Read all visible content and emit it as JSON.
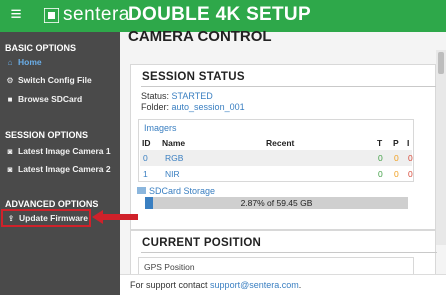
{
  "header": {
    "menu_icon": "≡",
    "logo_text": "sentera",
    "title": "DOUBLE 4K SETUP",
    "brand_color": "#2ea84a"
  },
  "sidebar": {
    "sections": [
      {
        "title": "BASIC OPTIONS"
      },
      {
        "title": "SESSION OPTIONS"
      },
      {
        "title": "ADVANCED OPTIONS"
      }
    ],
    "items": [
      {
        "label": "Home",
        "icon": "home-icon",
        "active": true
      },
      {
        "label": "Switch Config File",
        "icon": "gears-icon"
      },
      {
        "label": "Browse SDCard",
        "icon": "folder-icon"
      },
      {
        "label": "Latest Image Camera 1",
        "icon": "camera-icon"
      },
      {
        "label": "Latest Image Camera 2",
        "icon": "camera-icon"
      },
      {
        "label": "Update Firmware",
        "icon": "upload-icon",
        "highlighted": true
      }
    ]
  },
  "main": {
    "title": "CAMERA CONTROL",
    "session_status": {
      "title": "SESSION STATUS",
      "status_label": "Status:",
      "status_value": "STARTED",
      "folder_label": "Folder:",
      "folder_value": "auto_session_001"
    },
    "imagers": {
      "label": "Imagers",
      "columns": [
        "ID",
        "Name",
        "Recent",
        "T",
        "P",
        "I"
      ],
      "rows": [
        {
          "id": "0",
          "name": "RGB",
          "recent": "",
          "t": "0",
          "p": "0",
          "i": "0"
        },
        {
          "id": "1",
          "name": "NIR",
          "recent": "",
          "t": "0",
          "p": "0",
          "i": "0"
        }
      ]
    },
    "sdcard": {
      "label": "SDCard Storage",
      "usage_text": "2.87% of 59.45 GB",
      "used_fraction": 0.0287
    },
    "current_position": {
      "title": "CURRENT POSITION",
      "gps_label": "GPS Position"
    }
  },
  "footer": {
    "text": "For support contact ",
    "email": "support@sentera.com",
    "end": "."
  }
}
